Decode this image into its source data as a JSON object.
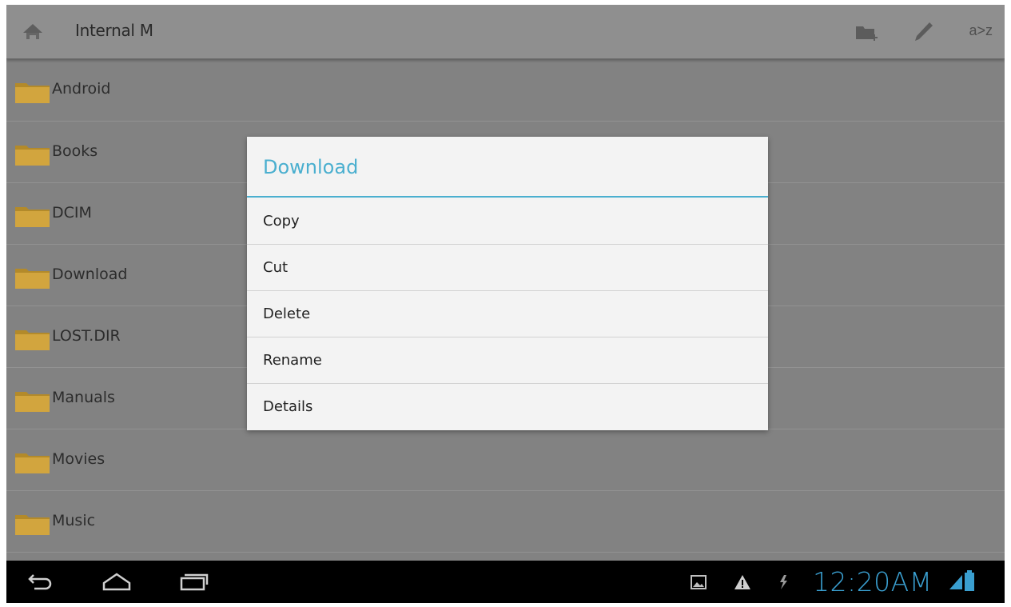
{
  "action_bar": {
    "title": "Internal M",
    "sort_label": "a>z"
  },
  "folders": [
    {
      "name": "Android"
    },
    {
      "name": "Books"
    },
    {
      "name": "DCIM"
    },
    {
      "name": "Download"
    },
    {
      "name": "LOST.DIR"
    },
    {
      "name": "Manuals"
    },
    {
      "name": "Movies"
    },
    {
      "name": "Music"
    }
  ],
  "dialog": {
    "title": "Download",
    "items": [
      {
        "label": "Copy"
      },
      {
        "label": "Cut"
      },
      {
        "label": "Delete"
      },
      {
        "label": "Rename"
      },
      {
        "label": "Details"
      }
    ]
  },
  "status_bar": {
    "time": "12:20AM"
  },
  "colors": {
    "accent": "#4aafcf",
    "clock": "#3a9fd0",
    "folder": "#c9a13d"
  }
}
